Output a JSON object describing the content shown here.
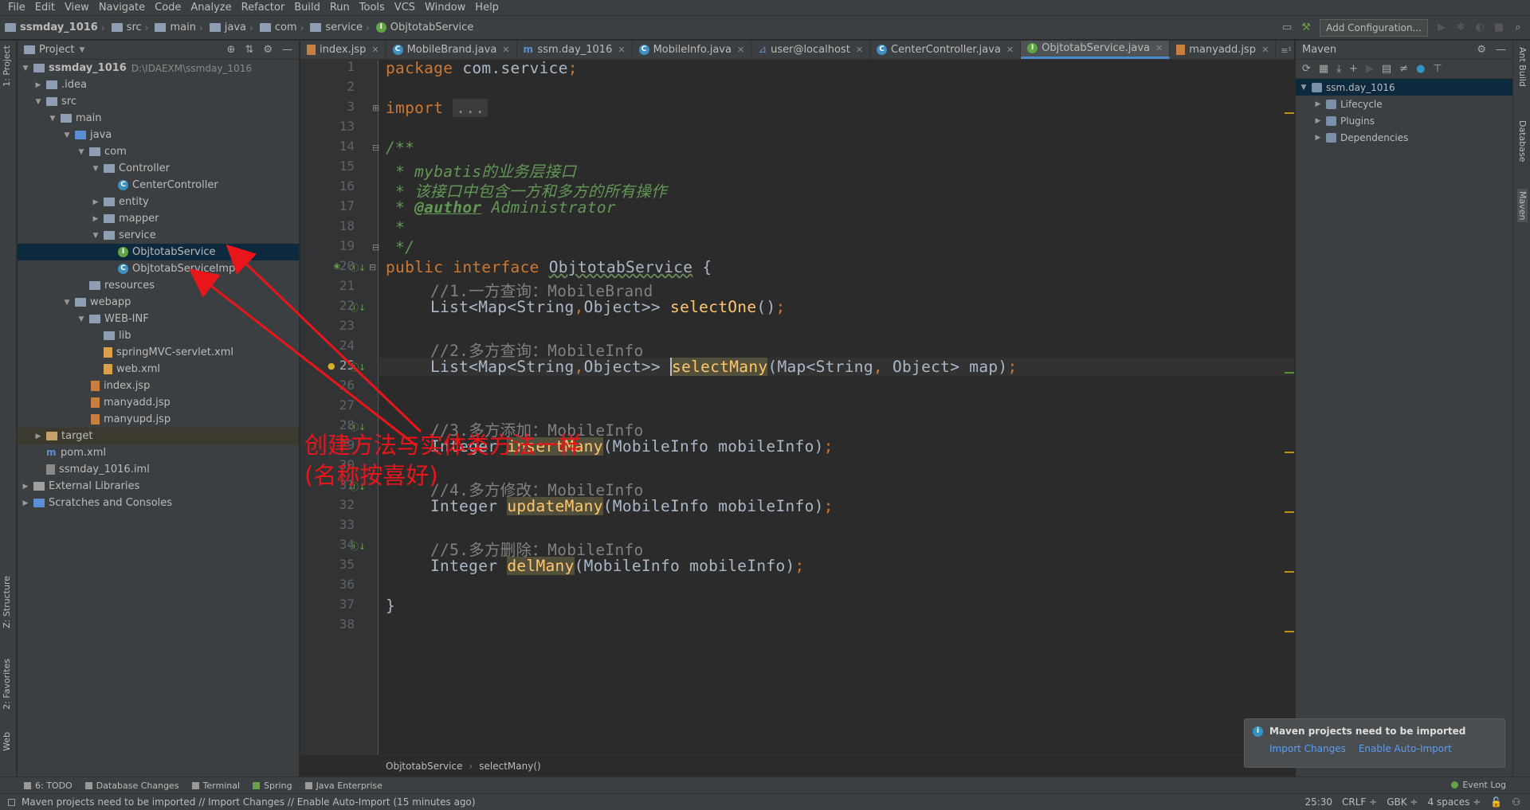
{
  "menu": [
    "File",
    "Edit",
    "View",
    "Navigate",
    "Code",
    "Analyze",
    "Refactor",
    "Build",
    "Run",
    "Tools",
    "VCS",
    "Window",
    "Help"
  ],
  "breadcrumbs": [
    "ssmday_1016",
    "src",
    "main",
    "java",
    "com",
    "service",
    "ObjtotabService"
  ],
  "toolbar": {
    "add_config": "Add Configuration..."
  },
  "left_stripe": {
    "project": "1: Project",
    "structure": "Z: Structure",
    "favorites": "2: Favorites",
    "web": "Web"
  },
  "right_stripe": {
    "ant": "Ant Build",
    "database": "Database",
    "maven": "Maven"
  },
  "project_panel": {
    "title": "Project",
    "root": {
      "name": "ssmday_1016",
      "path": "D:\\IDAEXM\\ssmday_1016"
    },
    "items": [
      ".idea",
      "src",
      "main",
      "java",
      "com",
      "Controller",
      "CenterController",
      "entity",
      "mapper",
      "service",
      "ObjtotabService",
      "ObjtotabServiceImpl",
      "resources",
      "webapp",
      "WEB-INF",
      "lib",
      "springMVC-servlet.xml",
      "web.xml",
      "index.jsp",
      "manyadd.jsp",
      "manyupd.jsp",
      "target",
      "pom.xml",
      "ssmday_1016.iml",
      "External Libraries",
      "Scratches and Consoles"
    ]
  },
  "editor_tabs": [
    "index.jsp",
    "MobileBrand.java",
    "ssm.day_1016",
    "MobileInfo.java",
    "user@localhost",
    "CenterController.java",
    "ObjtotabService.java",
    "manyadd.jsp"
  ],
  "code": {
    "line_numbers": [
      "1",
      "2",
      "3",
      "13",
      "14",
      "15",
      "16",
      "17",
      "18",
      "19",
      "20",
      "21",
      "22",
      "23",
      "24",
      "25",
      "26",
      "27",
      "28",
      "29",
      "30",
      "31",
      "32",
      "33",
      "34",
      "35",
      "36",
      "37",
      "38"
    ],
    "l1_kw": "package",
    "l1_rest": " com.service",
    "semi": ";",
    "l3_kw": "import",
    "l3_fold": "...",
    "l14": "/**",
    "l15_a": " * ",
    "l15_b": "mybatis的业务层接口",
    "l16": " * 该接口中包含一方和多方的所有操作",
    "l17_a": " * ",
    "l17_tag": "@author",
    "l17_b": " Administrator",
    "l18": " *",
    "l19": " */",
    "l20_kw1": "public",
    "l20_kw2": "interface",
    "l20_name": "ObjtotabService",
    "l20_brace": " {",
    "l21": "//1.一方查询：MobileBrand",
    "l22_type": "List<Map<String",
    "l22_comma": ",",
    "l22_type2": "Object>> ",
    "l22_fn": "selectOne",
    "l22_args": "()",
    "l24": "//2.多方查询：MobileInfo",
    "l25_type": "List<Map<String",
    "l25_type2": "Object>> ",
    "l25_fn": "selectMany",
    "l25_args_a": "(Map<String",
    "l25_args_b": " Object> map)",
    "l28": "//3.多方添加：MobileInfo",
    "l29_type": "Integer ",
    "l29_fn": "insertMany",
    "l29_args": "(MobileInfo mobileInfo)",
    "l31": "//4.多方修改：MobileInfo",
    "l32_type": "Integer ",
    "l32_fn": "updateMany",
    "l32_args": "(MobileInfo mobileInfo)",
    "l34": "//5.多方删除：MobileInfo",
    "l35_type": "Integer ",
    "l35_fn": "delMany",
    "l35_args": "(MobileInfo mobileInfo)",
    "l37": "}"
  },
  "editor_crumb": [
    "ObjtotabService",
    "selectMany()"
  ],
  "maven": {
    "title": "Maven",
    "root": "ssm.day_1016",
    "children": [
      "Lifecycle",
      "Plugins",
      "Dependencies"
    ]
  },
  "notification": {
    "title": "Maven projects need to be imported",
    "import_changes": "Import Changes",
    "enable_auto": "Enable Auto-Import"
  },
  "tool_tabs": [
    "6: TODO",
    "Database Changes",
    "Terminal",
    "Spring",
    "Java Enterprise"
  ],
  "event_log": "Event Log",
  "status": {
    "message": "Maven projects need to be imported // Import Changes // Enable Auto-Import (15 minutes ago)",
    "position": "25:30",
    "line_sep": "CRLF ÷",
    "encoding": "GBK ÷",
    "indent": "4 spaces ÷"
  },
  "annotation": {
    "line1": "创建方法与实体类方法一样",
    "line2": "(名称按喜好)",
    "color": "#e8161b"
  }
}
